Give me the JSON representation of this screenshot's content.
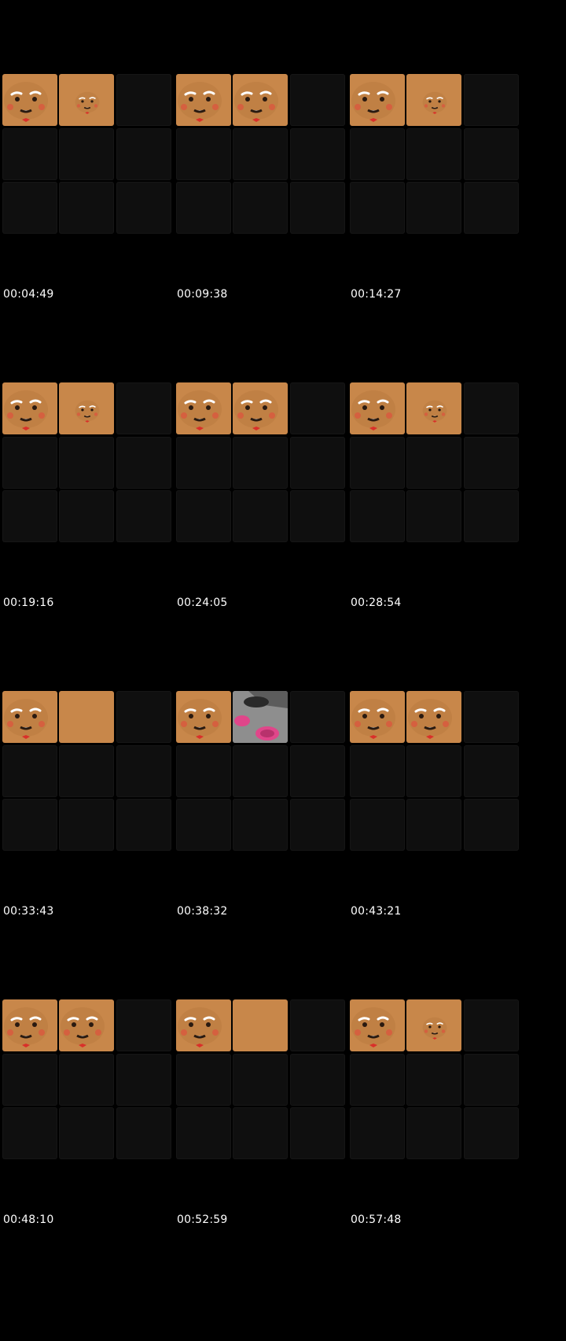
{
  "colors": {
    "background": "#000000",
    "tile_empty": "#0f0f0f",
    "tile_cookie": "#c8874a",
    "timestamp_text": "#ffffff"
  },
  "frames": [
    {
      "timestamp": "00:04:49",
      "tiles": [
        "cookie-face",
        "cookie-face-small",
        "empty",
        "empty",
        "empty",
        "empty",
        "empty",
        "empty",
        "empty"
      ]
    },
    {
      "timestamp": "00:09:38",
      "tiles": [
        "cookie-face",
        "cookie-face",
        "empty",
        "empty",
        "empty",
        "empty",
        "empty",
        "empty",
        "empty"
      ]
    },
    {
      "timestamp": "00:14:27",
      "tiles": [
        "cookie-face",
        "cookie-face-small",
        "empty",
        "empty",
        "empty",
        "empty",
        "empty",
        "empty",
        "empty"
      ]
    },
    {
      "timestamp": "00:19:16",
      "tiles": [
        "cookie-face",
        "cookie-face-small",
        "empty",
        "empty",
        "empty",
        "empty",
        "empty",
        "empty",
        "empty"
      ]
    },
    {
      "timestamp": "00:24:05",
      "tiles": [
        "cookie-face",
        "cookie-face",
        "empty",
        "empty",
        "empty",
        "empty",
        "empty",
        "empty",
        "empty"
      ]
    },
    {
      "timestamp": "00:28:54",
      "tiles": [
        "cookie-face",
        "cookie-face-small",
        "empty",
        "empty",
        "empty",
        "empty",
        "empty",
        "empty",
        "empty"
      ]
    },
    {
      "timestamp": "00:33:43",
      "tiles": [
        "cookie-face",
        "cookie-blank",
        "empty",
        "empty",
        "empty",
        "empty",
        "empty",
        "empty",
        "empty"
      ]
    },
    {
      "timestamp": "00:38:32",
      "tiles": [
        "cookie-face",
        "camera-photo",
        "empty",
        "empty",
        "empty",
        "empty",
        "empty",
        "empty",
        "empty"
      ]
    },
    {
      "timestamp": "00:43:21",
      "tiles": [
        "cookie-face",
        "cookie-face",
        "empty",
        "empty",
        "empty",
        "empty",
        "empty",
        "empty",
        "empty"
      ]
    },
    {
      "timestamp": "00:48:10",
      "tiles": [
        "cookie-face",
        "cookie-face",
        "empty",
        "empty",
        "empty",
        "empty",
        "empty",
        "empty",
        "empty"
      ]
    },
    {
      "timestamp": "00:52:59",
      "tiles": [
        "cookie-face",
        "cookie-blank",
        "empty",
        "empty",
        "empty",
        "empty",
        "empty",
        "empty",
        "empty"
      ]
    },
    {
      "timestamp": "00:57:48",
      "tiles": [
        "cookie-face",
        "cookie-face-small",
        "empty",
        "empty",
        "empty",
        "empty",
        "empty",
        "empty",
        "empty"
      ]
    }
  ]
}
